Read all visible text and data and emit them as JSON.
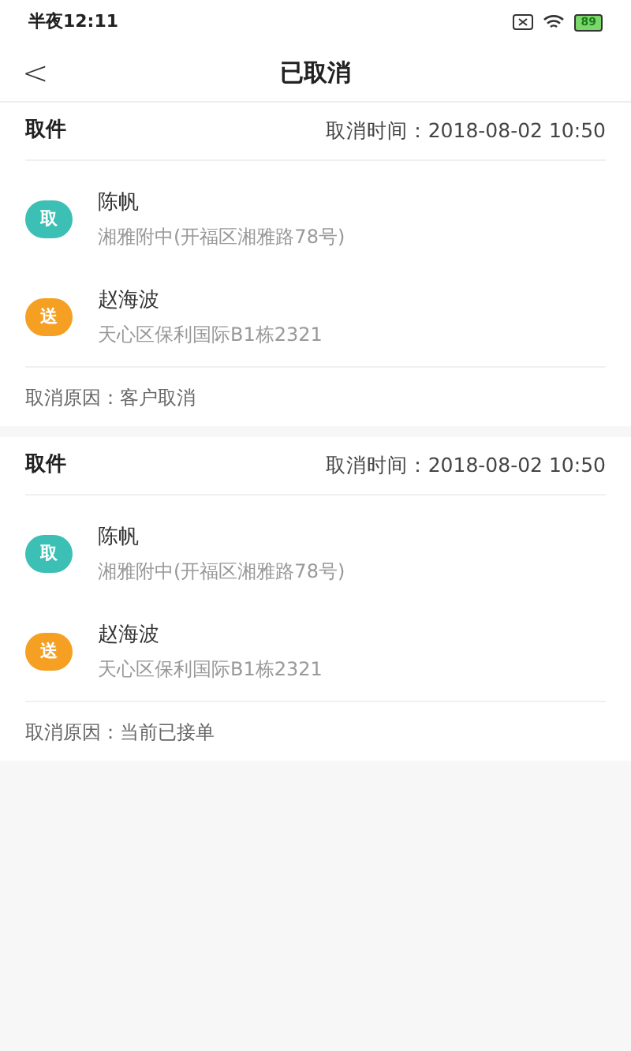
{
  "status_bar": {
    "time": "半夜12:11",
    "battery": "89"
  },
  "nav": {
    "back": "<",
    "title": "已取消"
  },
  "orders": [
    {
      "type": "取件",
      "cancel_time": "取消时间：2018-08-02 10:50",
      "stops": [
        {
          "badge": "取",
          "color": "#3cbfb4",
          "name": "陈帆",
          "address": "湘雅附中(开福区湘雅路78号)"
        },
        {
          "badge": "送",
          "color": "#f5a023",
          "name": "赵海波",
          "address": "天心区保利国际B1栋2321"
        }
      ],
      "reason": "取消原因：客户取消"
    },
    {
      "type": "取件",
      "cancel_time": "取消时间：2018-08-02 10:50",
      "stops": [
        {
          "badge": "取",
          "color": "#3cbfb4",
          "name": "陈帆",
          "address": "湘雅附中(开福区湘雅路78号)"
        },
        {
          "badge": "送",
          "color": "#f5a023",
          "name": "赵海波",
          "address": "天心区保利国际B1栋2321"
        }
      ],
      "reason": "取消原因：当前已接单"
    }
  ]
}
